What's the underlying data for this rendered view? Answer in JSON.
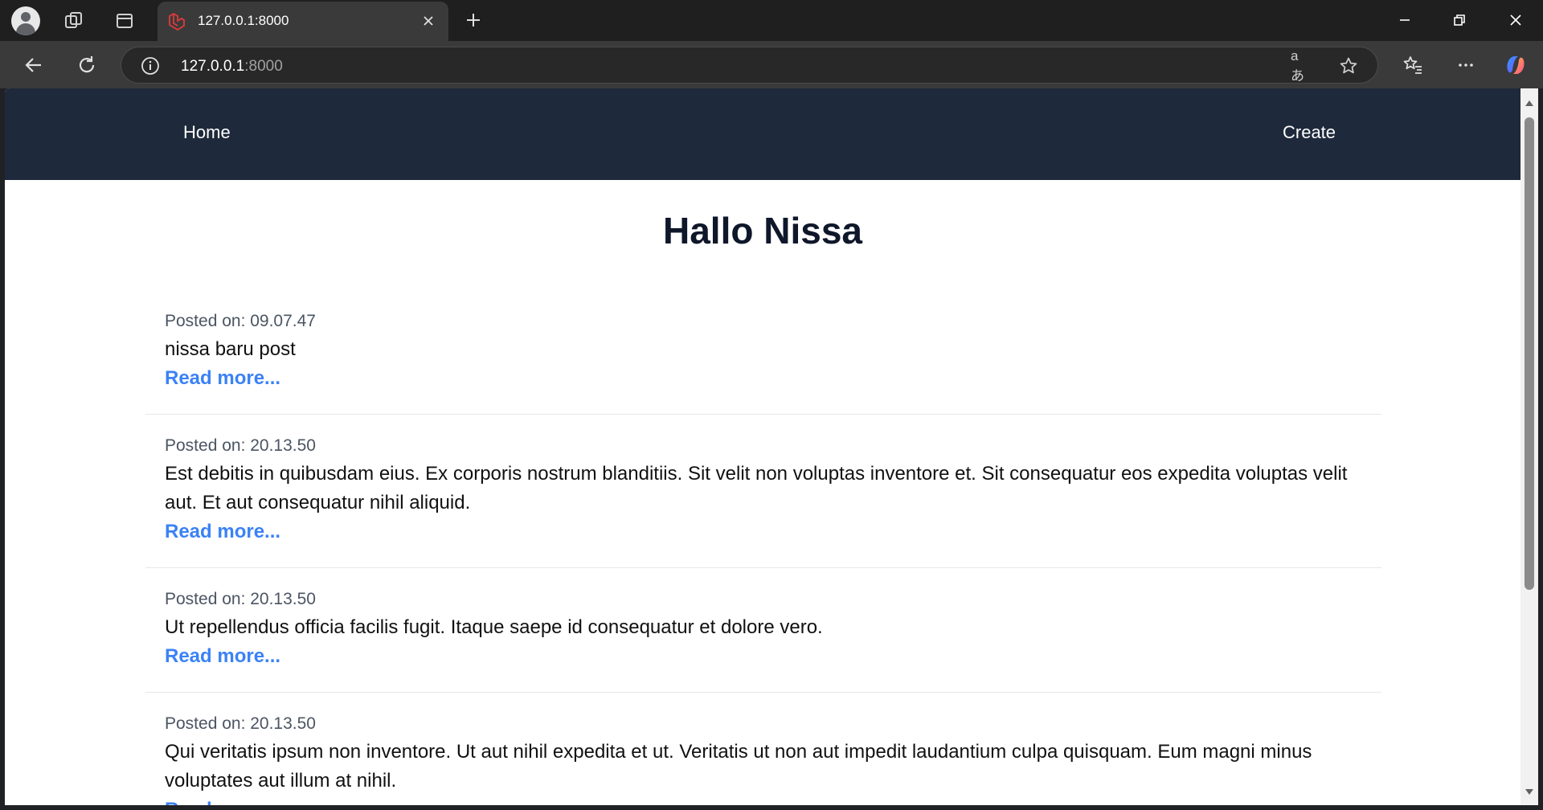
{
  "browser": {
    "tab_title": "127.0.0.1:8000",
    "url_host": "127.0.0.1",
    "url_port": ":8000",
    "translate_glyph": "aあ"
  },
  "nav": {
    "home": "Home",
    "create": "Create"
  },
  "heading": "Hallo Nissa",
  "posts": [
    {
      "date": "Posted on: 09.07.47",
      "body": "nissa baru post",
      "link": "Read more..."
    },
    {
      "date": "Posted on: 20.13.50",
      "body": "Est debitis in quibusdam eius. Ex corporis nostrum blanditiis. Sit velit non voluptas inventore et. Sit consequatur eos expedita voluptas velit aut. Et aut consequatur nihil aliquid.",
      "link": "Read more..."
    },
    {
      "date": "Posted on: 20.13.50",
      "body": "Ut repellendus officia facilis fugit. Itaque saepe id consequatur et dolore vero.",
      "link": "Read more..."
    },
    {
      "date": "Posted on: 20.13.50",
      "body": "Qui veritatis ipsum non inventore. Ut aut nihil expedita et ut. Veritatis ut non aut impedit laudantium culpa quisquam. Eum magni minus voluptates aut illum at nihil.",
      "link": "Read more..."
    }
  ],
  "colors": {
    "nav_bg": "#1e293b",
    "link": "#3b82f6",
    "heading": "#0f172a"
  }
}
